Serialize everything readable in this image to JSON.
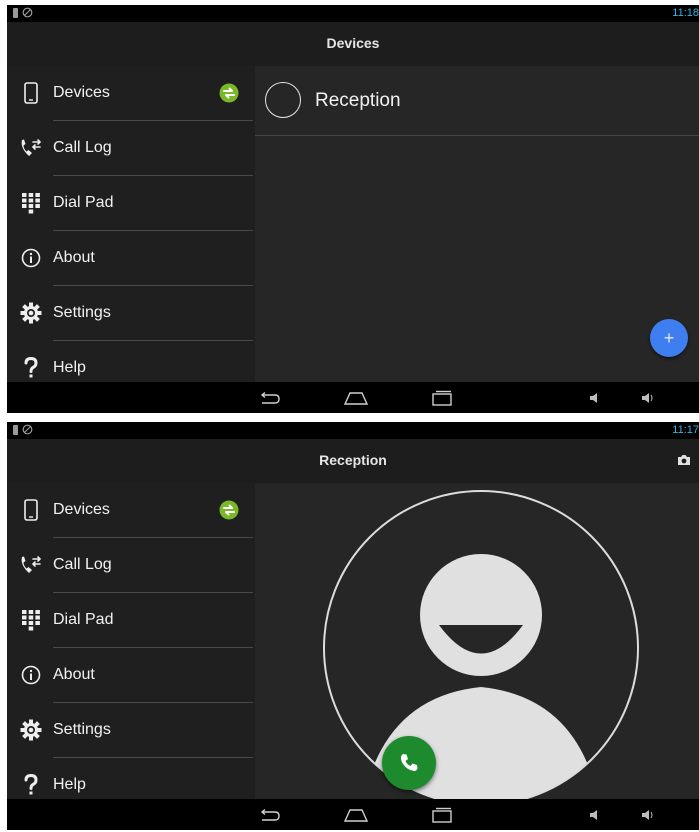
{
  "colors": {
    "status_time": "#33b5e5",
    "sync_badge": "#7ab829",
    "fab": "#3f7ef0",
    "call_button": "#1e8a2e"
  },
  "nav_items": [
    {
      "label": "Devices",
      "icon": "phone-icon"
    },
    {
      "label": "Call Log",
      "icon": "call-log-icon"
    },
    {
      "label": "Dial Pad",
      "icon": "dialpad-icon"
    },
    {
      "label": "About",
      "icon": "info-icon"
    },
    {
      "label": "Settings",
      "icon": "gear-icon"
    },
    {
      "label": "Help",
      "icon": "question-icon"
    }
  ],
  "screen1": {
    "status_time": "11:18",
    "title": "Devices",
    "devices": [
      {
        "name": "Reception"
      }
    ],
    "fab_symbol": "+"
  },
  "screen2": {
    "status_time": "11:17",
    "title": "Reception"
  }
}
